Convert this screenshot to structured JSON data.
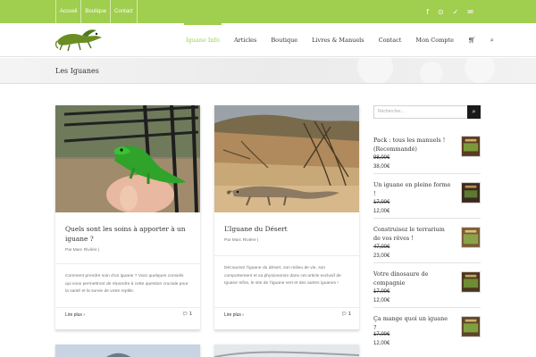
{
  "topbar": {
    "links": [
      "Accueil",
      "Boutique",
      "Contact"
    ],
    "social_icons": [
      "facebook-icon",
      "rss-icon",
      "twitter-icon",
      "mail-icon"
    ]
  },
  "nav": {
    "items": [
      "Iguane Info",
      "Articles",
      "Boutique",
      "Livres & Manuels",
      "Contact",
      "Mon Compte"
    ],
    "active": "Iguane Info",
    "cart_icon": "cart-icon",
    "search_icon": "search-icon"
  },
  "page": {
    "title": "Les Iguanes"
  },
  "posts": [
    {
      "title": "Quels sont les soins à apporter à un iguane ?",
      "meta": "Par Marc Rivière |",
      "excerpt": "Comment prendre soin d’un iguane ? Voici quelques conseils qui vous permettront de répondre à cette question cruciale pour la santé et la survie de votre reptile.",
      "more": "Lire plus",
      "comments": "1"
    },
    {
      "title": "L’Iguane du Désert",
      "meta": "Par Marc Rivière |",
      "excerpt": "Découvrez l’iguane du désert, son milieu de vie, son comportement et sa physionomie dans cet article exclusif de Iguane Infos, le site de l’iguane vert et des autres iguanes !",
      "more": "Lire plus",
      "comments": "1"
    }
  ],
  "sidebar": {
    "search_placeholder": "Rechercher...",
    "products": [
      {
        "name": "Pack : tous les manuels ! (Recommandé)",
        "old_price": "98,00€",
        "new_price": "38,00€"
      },
      {
        "name": "Un iguane en pleine forme !",
        "old_price": "17,00€",
        "new_price": "12,00€"
      },
      {
        "name": "Construisez le terrarium de vos rêves !",
        "old_price": "47,00€",
        "new_price": "23,00€"
      },
      {
        "name": "Votre dinosaure de compagnie",
        "old_price": "17,00€",
        "new_price": "12,00€"
      },
      {
        "name": "Ça mange quoi un iguane ?",
        "old_price": "17,00€",
        "new_price": "12,00€"
      }
    ]
  },
  "colors": {
    "accent": "#a0ce4e",
    "text": "#333333",
    "muted": "#747474"
  }
}
